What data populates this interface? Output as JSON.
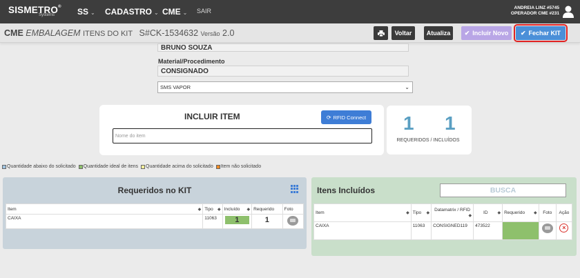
{
  "nav": {
    "logo": "SISMETRO",
    "logo_reg": "®",
    "logo_sub": "Systems",
    "items": [
      {
        "label": "SS"
      },
      {
        "label": "CADASTRO"
      },
      {
        "label": "CME"
      }
    ],
    "sair": "SAIR",
    "user_name": "ANDREIA LINZ #5745",
    "user_role": "OPERADOR CME #231"
  },
  "subheader": {
    "title_bold": "CME",
    "title_italic": "EMBALAGEM",
    "title_rest": "ITENS DO KIT",
    "kit_code": "S#CK-1534632",
    "version_label": "Versão",
    "version_value": "2.0",
    "buttons": {
      "voltar": "Voltar",
      "atualiza": "Atualiza",
      "incluir_novo": "Incluir Novo",
      "fechar_kit": "Fechar KIT"
    }
  },
  "form": {
    "responsavel_value": "BRUNO SOUZA",
    "material_label": "Material/Procedimento",
    "material_value": "CONSIGNADO",
    "process_select": "SMS VAPOR"
  },
  "incluir": {
    "title": "INCLUIR ITEM",
    "rfid_button": "RFID Connect",
    "input_placeholder": "Nome do item"
  },
  "counts": {
    "requeridos": "1",
    "incluidos": "1",
    "label": "REQUERIDOS / INCLUÍDOS"
  },
  "legend": [
    {
      "label": "Quantidade abaixo do solicitado",
      "color": "#9fc3e0"
    },
    {
      "label": "Quantidade ideal de itens",
      "color": "#8ec06c"
    },
    {
      "label": "Quantidade acima do solicitado",
      "color": "#f6ef9a"
    },
    {
      "label": "Item não solicitado",
      "color": "#f08a24"
    }
  ],
  "requeridos_panel": {
    "title": "Requeridos no KIT",
    "columns": [
      "Item",
      "Tipo",
      "Incluído",
      "Requerido",
      "Foto"
    ],
    "rows": [
      {
        "item": "CAIXA",
        "tipo": "11063",
        "incluido": "1",
        "requerido": "1"
      }
    ]
  },
  "incluidos_panel": {
    "title": "Itens Incluídos",
    "busca": "BUSCA",
    "columns": [
      "Item",
      "Tipo",
      "Datamatrix / RFID",
      "ID",
      "Requerido",
      "Foto",
      "Ação"
    ],
    "rows": [
      {
        "item": "CAIXA",
        "tipo": "11063",
        "datamatrix": "CONSIGNED119",
        "id": "473522",
        "requerido": ""
      }
    ]
  }
}
